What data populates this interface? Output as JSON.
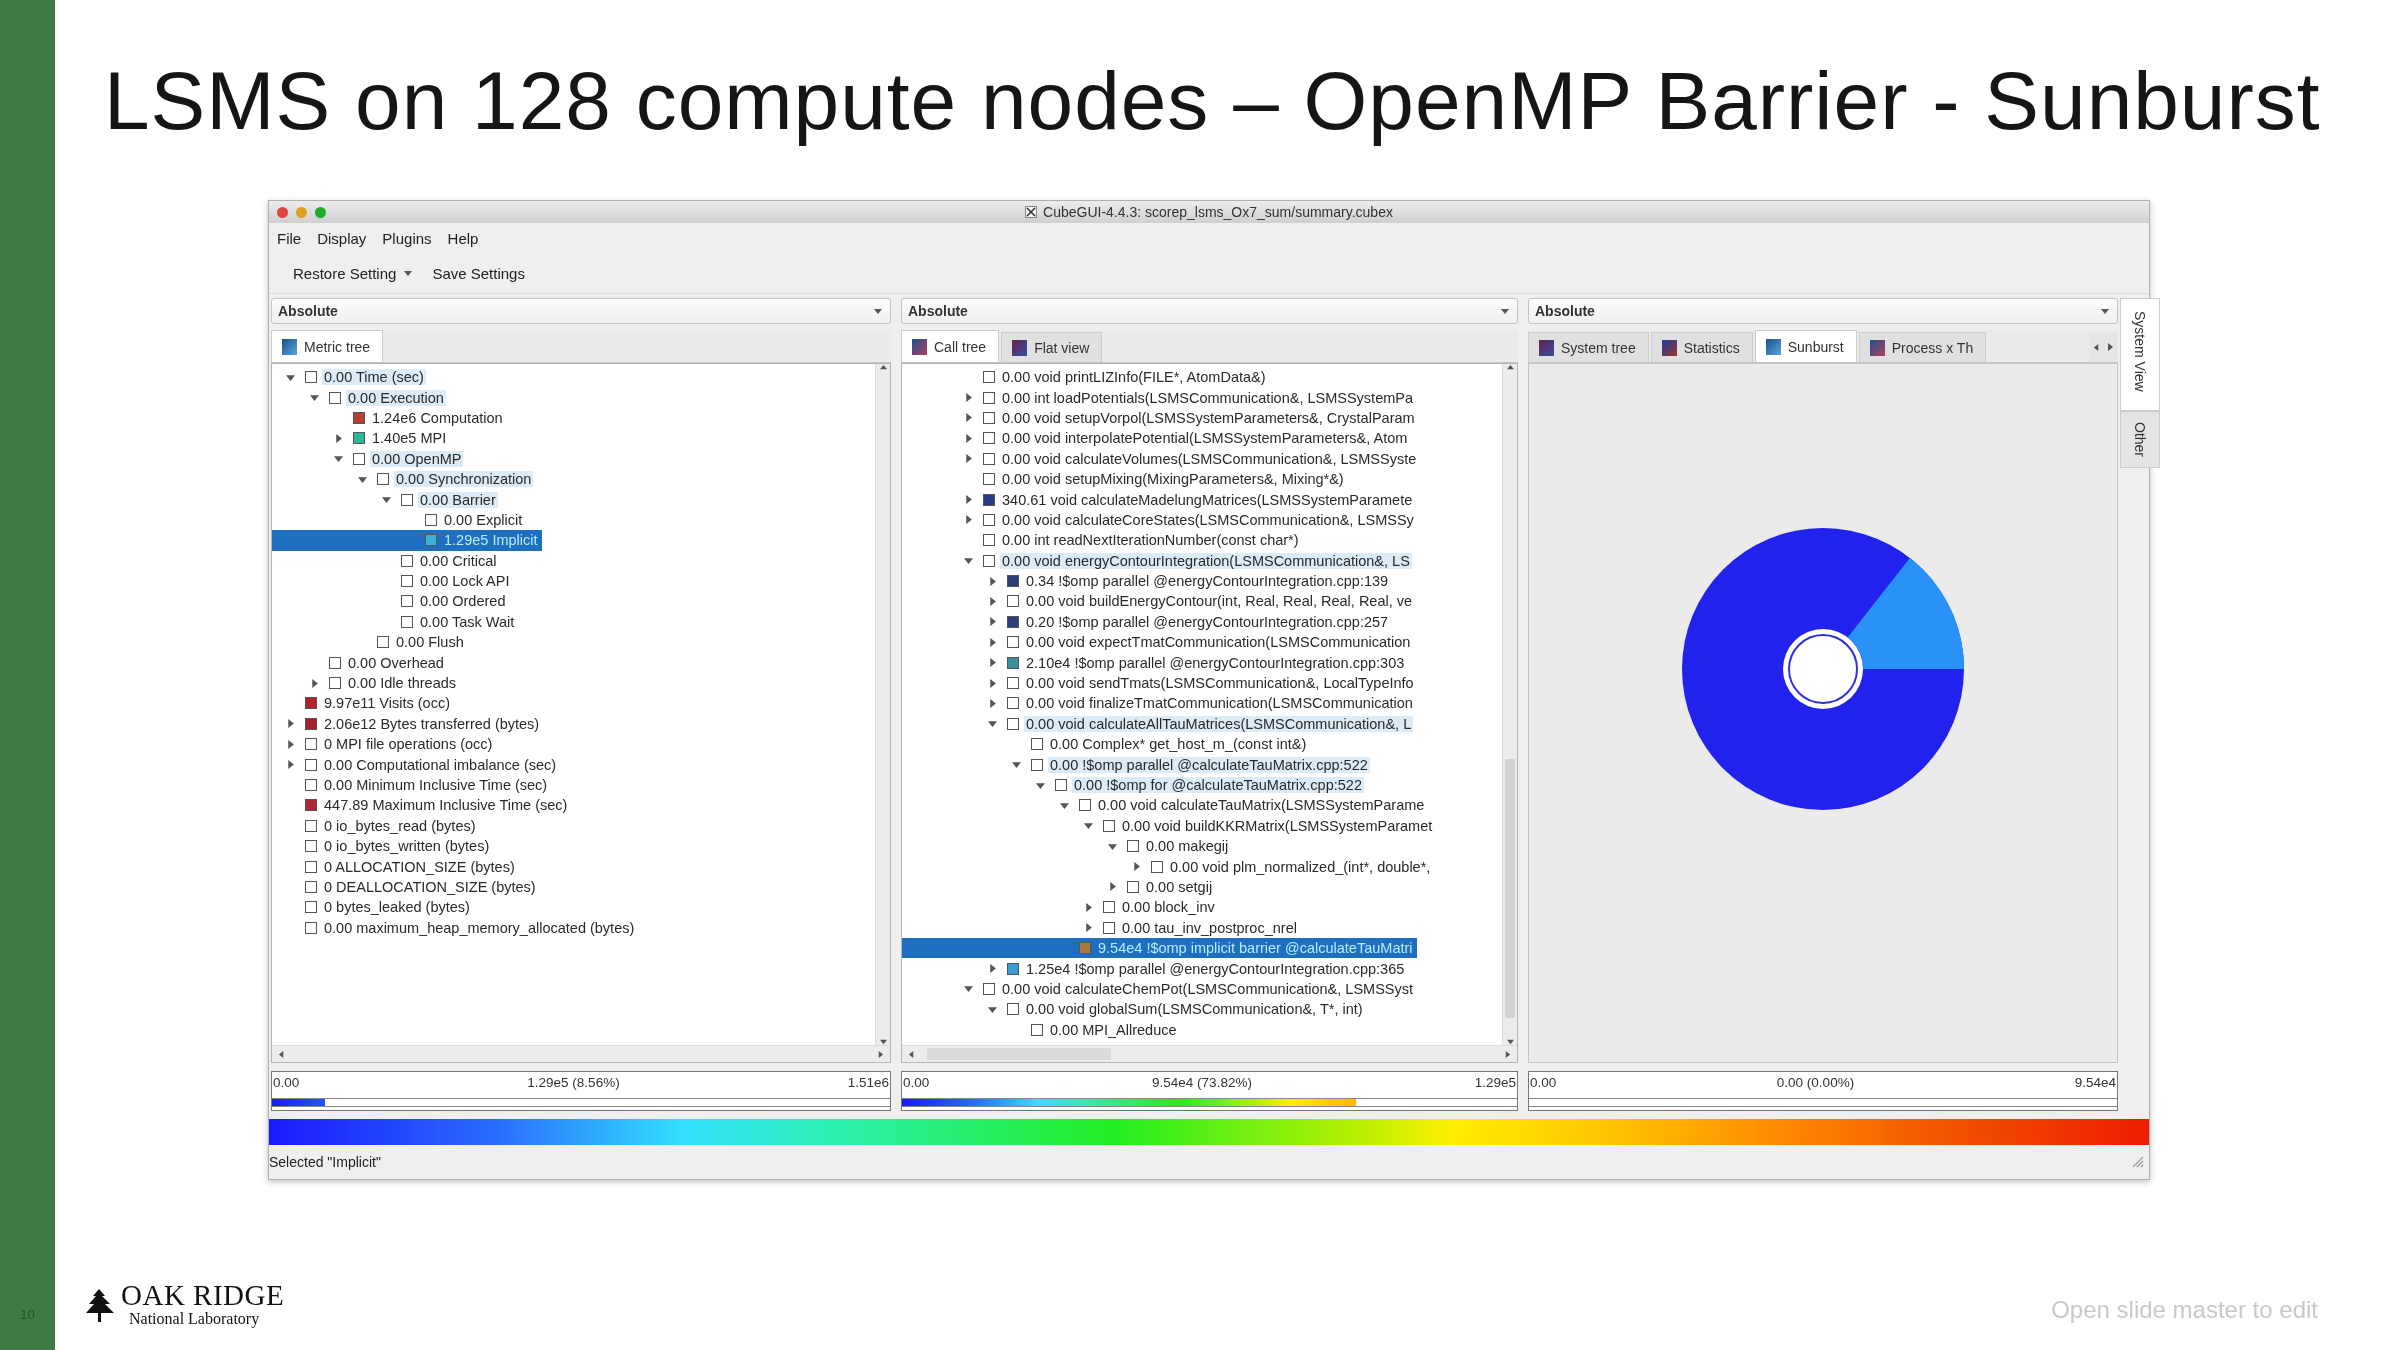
{
  "slide": {
    "title": "LSMS on 128 compute nodes – OpenMP Barrier - Sunburst",
    "number": "10",
    "logo": {
      "line1": "OAK RIDGE",
      "line2": "National Laboratory"
    },
    "footer_note": "Open slide master to edit"
  },
  "window": {
    "title": "CubeGUI-4.4.3: scorep_lsms_Ox7_sum/summary.cubex",
    "menu": [
      "File",
      "Display",
      "Plugins",
      "Help"
    ],
    "toolbar": [
      {
        "label": "Restore Setting",
        "dropdown": true
      },
      {
        "label": "Save Settings",
        "dropdown": false
      }
    ]
  },
  "panels": [
    {
      "kind": "tree",
      "mode": "Absolute",
      "tabs_overflow": false,
      "tabs": [
        {
          "label": "Metric tree",
          "selected": true
        }
      ],
      "tree": [
        {
          "label": "0.00 Time (sec)",
          "color": "#ffffff",
          "expanded": true,
          "selected": false,
          "highlighted": true,
          "children": [
            {
              "label": "0.00 Execution",
              "color": "#ffffff",
              "expanded": true,
              "selected": false,
              "highlighted": true,
              "children": [
                {
                  "label": "1.24e6 Computation",
                  "color": "#b5402f",
                  "selected": false,
                  "highlighted": false
                },
                {
                  "label": "1.40e5 MPI",
                  "color": "#2fb59c",
                  "expanded": false,
                  "selected": false,
                  "highlighted": false
                },
                {
                  "label": "0.00 OpenMP",
                  "color": "#ffffff",
                  "expanded": true,
                  "selected": false,
                  "highlighted": true,
                  "children": [
                    {
                      "label": "0.00 Synchronization",
                      "color": "#ffffff",
                      "expanded": true,
                      "selected": false,
                      "highlighted": true,
                      "children": [
                        {
                          "label": "0.00 Barrier",
                          "color": "#ffffff",
                          "expanded": true,
                          "selected": false,
                          "highlighted": true,
                          "children": [
                            {
                              "label": "0.00 Explicit",
                              "color": "#ffffff",
                              "selected": false,
                              "highlighted": false
                            },
                            {
                              "label": "1.29e5 Implicit",
                              "color": "#3ab4d4",
                              "selected": true,
                              "highlighted": false
                            }
                          ]
                        },
                        {
                          "label": "0.00 Critical",
                          "color": "#ffffff",
                          "selected": false,
                          "highlighted": false
                        },
                        {
                          "label": "0.00 Lock API",
                          "color": "#ffffff",
                          "selected": false,
                          "highlighted": false
                        },
                        {
                          "label": "0.00 Ordered",
                          "color": "#ffffff",
                          "selected": false,
                          "highlighted": false
                        },
                        {
                          "label": "0.00 Task Wait",
                          "color": "#ffffff",
                          "selected": false,
                          "highlighted": false
                        }
                      ]
                    },
                    {
                      "label": "0.00 Flush",
                      "color": "#ffffff",
                      "selected": false,
                      "highlighted": false
                    }
                  ]
                }
              ]
            },
            {
              "label": "0.00 Overhead",
              "color": "#ffffff",
              "selected": false,
              "highlighted": false
            },
            {
              "label": "0.00 Idle threads",
              "color": "#ffffff",
              "expanded": false,
              "selected": false,
              "highlighted": false
            }
          ]
        },
        {
          "label": "9.97e11 Visits (occ)",
          "color": "#b3202c",
          "selected": false,
          "highlighted": false
        },
        {
          "label": "2.06e12 Bytes transferred (bytes)",
          "color": "#a51f2e",
          "expanded": false,
          "selected": false,
          "highlighted": false
        },
        {
          "label": "0 MPI file operations (occ)",
          "color": "#ffffff",
          "expanded": false,
          "selected": false,
          "highlighted": false
        },
        {
          "label": "0.00 Computational imbalance (sec)",
          "color": "#ffffff",
          "expanded": false,
          "selected": false,
          "highlighted": false
        },
        {
          "label": "0.00 Minimum Inclusive Time (sec)",
          "color": "#ffffff",
          "selected": false,
          "highlighted": false
        },
        {
          "label": "447.89 Maximum Inclusive Time (sec)",
          "color": "#a8283a",
          "selected": false,
          "highlighted": false
        },
        {
          "label": "0 io_bytes_read (bytes)",
          "color": "#ffffff",
          "selected": false,
          "highlighted": false
        },
        {
          "label": "0 io_bytes_written (bytes)",
          "color": "#ffffff",
          "selected": false,
          "highlighted": false
        },
        {
          "label": "0 ALLOCATION_SIZE (bytes)",
          "color": "#ffffff",
          "selected": false,
          "highlighted": false
        },
        {
          "label": "0 DEALLOCATION_SIZE (bytes)",
          "color": "#ffffff",
          "selected": false,
          "highlighted": false
        },
        {
          "label": "0 bytes_leaked (bytes)",
          "color": "#ffffff",
          "selected": false,
          "highlighted": false
        },
        {
          "label": "0.00 maximum_heap_memory_allocated (bytes)",
          "color": "#ffffff",
          "selected": false,
          "highlighted": false
        }
      ],
      "value_bar": {
        "min": "0.00",
        "value": "1.29e5 (8.56%)",
        "max": "1.51e6",
        "level": 0.0856
      }
    },
    {
      "kind": "tree",
      "mode": "Absolute",
      "tabs_overflow": false,
      "tabs": [
        {
          "label": "Call tree",
          "selected": true
        },
        {
          "label": "Flat view",
          "selected": false
        }
      ],
      "tree": [
        {
          "label": "0.00 void printLIZInfo(FILE*, AtomData&)",
          "color": "#ffffff",
          "selected": false,
          "highlighted": false
        },
        {
          "label": "0.00 int loadPotentials(LSMSCommunication&, LSMSSystemPa",
          "color": "#ffffff",
          "expanded": false,
          "selected": false,
          "highlighted": false
        },
        {
          "label": "0.00 void setupVorpol(LSMSSystemParameters&, CrystalParam",
          "color": "#ffffff",
          "expanded": false,
          "selected": false,
          "highlighted": false
        },
        {
          "label": "0.00 void interpolatePotential(LSMSSystemParameters&, Atom",
          "color": "#ffffff",
          "expanded": false,
          "selected": false,
          "highlighted": false
        },
        {
          "label": "0.00 void calculateVolumes(LSMSCommunication&, LSMSSyste",
          "color": "#ffffff",
          "expanded": false,
          "selected": false,
          "highlighted": false
        },
        {
          "label": "0.00 void setupMixing(MixingParameters&, Mixing*&)",
          "color": "#ffffff",
          "selected": false,
          "highlighted": false
        },
        {
          "label": "340.61 void calculateMadelungMatrices(LSMSSystemParamete",
          "color": "#2a3a86",
          "expanded": false,
          "selected": false,
          "highlighted": false
        },
        {
          "label": "0.00 void calculateCoreStates(LSMSCommunication&, LSMSSy",
          "color": "#ffffff",
          "expanded": false,
          "selected": false,
          "highlighted": false
        },
        {
          "label": "0.00 int readNextIterationNumber(const char*)",
          "color": "#ffffff",
          "selected": false,
          "highlighted": false
        },
        {
          "label": "0.00 void energyContourIntegration(LSMSCommunication&, LS",
          "color": "#ffffff",
          "expanded": true,
          "selected": false,
          "highlighted": true,
          "children": [
            {
              "label": "0.34 !$omp parallel @energyContourIntegration.cpp:139",
              "color": "#2c3f78",
              "expanded": false,
              "selected": false,
              "highlighted": false
            },
            {
              "label": "0.00 void buildEnergyContour(int, Real, Real, Real, Real, ve",
              "color": "#ffffff",
              "expanded": false,
              "selected": false,
              "highlighted": false
            },
            {
              "label": "0.20 !$omp parallel @energyContourIntegration.cpp:257",
              "color": "#2c3f78",
              "expanded": false,
              "selected": false,
              "highlighted": false
            },
            {
              "label": "0.00 void expectTmatCommunication(LSMSCommunication",
              "color": "#ffffff",
              "expanded": false,
              "selected": false,
              "highlighted": false
            },
            {
              "label": "2.10e4 !$omp parallel @energyContourIntegration.cpp:303",
              "color": "#3a8f9a",
              "expanded": false,
              "selected": false,
              "highlighted": false
            },
            {
              "label": "0.00 void sendTmats(LSMSCommunication&, LocalTypeInfo",
              "color": "#ffffff",
              "expanded": false,
              "selected": false,
              "highlighted": false
            },
            {
              "label": "0.00 void finalizeTmatCommunication(LSMSCommunication",
              "color": "#ffffff",
              "expanded": false,
              "selected": false,
              "highlighted": false
            },
            {
              "label": "0.00 void calculateAllTauMatrices(LSMSCommunication&, L",
              "color": "#ffffff",
              "expanded": true,
              "selected": false,
              "highlighted": true,
              "children": [
                {
                  "label": "0.00 Complex* get_host_m_(const int&)",
                  "color": "#ffffff",
                  "selected": false,
                  "highlighted": false
                },
                {
                  "label": "0.00 !$omp parallel @calculateTauMatrix.cpp:522",
                  "color": "#ffffff",
                  "expanded": true,
                  "selected": false,
                  "highlighted": true,
                  "children": [
                    {
                      "label": "0.00 !$omp for @calculateTauMatrix.cpp:522",
                      "color": "#ffffff",
                      "expanded": true,
                      "selected": false,
                      "highlighted": true,
                      "children": [
                        {
                          "label": "0.00 void calculateTauMatrix(LSMSSystemParame",
                          "color": "#ffffff",
                          "expanded": true,
                          "selected": false,
                          "highlighted": false,
                          "children": [
                            {
                              "label": "0.00 void buildKKRMatrix(LSMSSystemParamet",
                              "color": "#ffffff",
                              "expanded": true,
                              "selected": false,
                              "highlighted": false,
                              "children": [
                                {
                                  "label": "0.00 makegij",
                                  "color": "#ffffff",
                                  "expanded": true,
                                  "selected": false,
                                  "highlighted": false,
                                  "children": [
                                    {
                                      "label": "0.00 void plm_normalized_(int*, double*,",
                                      "color": "#ffffff",
                                      "expanded": false,
                                      "selected": false,
                                      "highlighted": false
                                    }
                                  ]
                                },
                                {
                                  "label": "0.00 setgij",
                                  "color": "#ffffff",
                                  "expanded": false,
                                  "selected": false,
                                  "highlighted": false
                                }
                              ]
                            },
                            {
                              "label": "0.00 block_inv",
                              "color": "#ffffff",
                              "expanded": false,
                              "selected": false,
                              "highlighted": false
                            },
                            {
                              "label": "0.00 tau_inv_postproc_nrel",
                              "color": "#ffffff",
                              "expanded": false,
                              "selected": false,
                              "highlighted": false
                            }
                          ]
                        },
                        {
                          "label": "9.54e4 !$omp implicit barrier @calculateTauMatri",
                          "color": "#a8783c",
                          "selected": true,
                          "highlighted": false
                        }
                      ]
                    }
                  ]
                }
              ]
            },
            {
              "label": "1.25e4 !$omp parallel @energyContourIntegration.cpp:365",
              "color": "#3a9ed0",
              "expanded": false,
              "selected": false,
              "highlighted": false
            }
          ]
        },
        {
          "label": "0.00 void calculateChemPot(LSMSCommunication&, LSMSSyst",
          "color": "#ffffff",
          "expanded": true,
          "selected": false,
          "highlighted": false,
          "children": [
            {
              "label": "0.00 void globalSum(LSMSCommunication&, T*, int)",
              "color": "#ffffff",
              "expanded": true,
              "selected": false,
              "highlighted": false,
              "children": [
                {
                  "label": "0.00 MPI_Allreduce",
                  "color": "#ffffff",
                  "selected": false,
                  "highlighted": false
                }
              ]
            }
          ]
        }
      ],
      "value_bar": {
        "min": "0.00",
        "value": "9.54e4 (73.82%)",
        "max": "1.29e5",
        "level": 0.7382
      }
    },
    {
      "kind": "sunburst",
      "mode": "Absolute",
      "tabs_overflow": true,
      "tabs": [
        {
          "label": "System tree",
          "selected": false
        },
        {
          "label": "Statistics",
          "selected": false
        },
        {
          "label": "Sunburst",
          "selected": true
        },
        {
          "label": "Process x Th",
          "selected": false
        }
      ],
      "value_bar": {
        "min": "0.00",
        "value": "0.00 (0.00%)",
        "max": "9.54e4",
        "level": 0
      }
    }
  ],
  "side_tabs": [
    {
      "label": "System View",
      "selected": true
    },
    {
      "label": "Other",
      "selected": false
    }
  ],
  "status_bar": "Selected \"Implicit\""
}
